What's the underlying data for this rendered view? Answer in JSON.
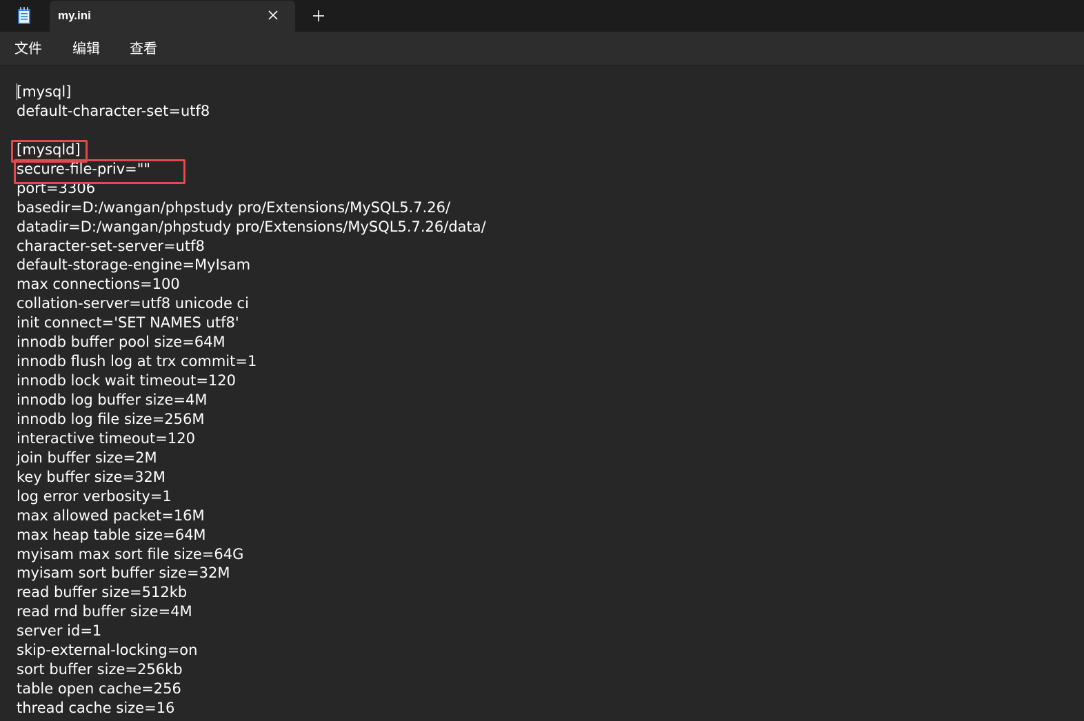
{
  "tab": {
    "title": "my.ini"
  },
  "menu": [
    "文件",
    "编辑",
    "查看"
  ],
  "icons": {
    "app": "notepad-icon",
    "close": "close-icon",
    "new_tab": "plus-icon"
  },
  "colors": {
    "highlight": "#e5484d",
    "text": "#ffffff",
    "background": "#272727"
  },
  "lines": [
    "[mysql]",
    "default-character-set=utf8",
    "",
    "[mysqld]",
    "secure-file-priv=\"\"",
    "port=3306",
    "basedir=D:/wangan/phpstudy pro/Extensions/MySQL5.7.26/",
    "datadir=D:/wangan/phpstudy pro/Extensions/MySQL5.7.26/data/",
    "character-set-server=utf8",
    "default-storage-engine=MyIsam",
    "max connections=100",
    "collation-server=utf8 unicode ci",
    "init connect='SET NAMES utf8'",
    "innodb buffer pool size=64M",
    "innodb flush log at trx commit=1",
    "innodb lock wait timeout=120",
    "innodb log buffer size=4M",
    "innodb log file size=256M",
    "interactive timeout=120",
    "join buffer size=2M",
    "key buffer size=32M",
    "log error verbosity=1",
    "max allowed packet=16M",
    "max heap table size=64M",
    "myisam max sort file size=64G",
    "myisam sort buffer size=32M",
    "read buffer size=512kb",
    "read rnd buffer size=4M",
    "server id=1",
    "skip-external-locking=on",
    "sort buffer size=256kb",
    "table open cache=256",
    "thread cache size=16"
  ]
}
